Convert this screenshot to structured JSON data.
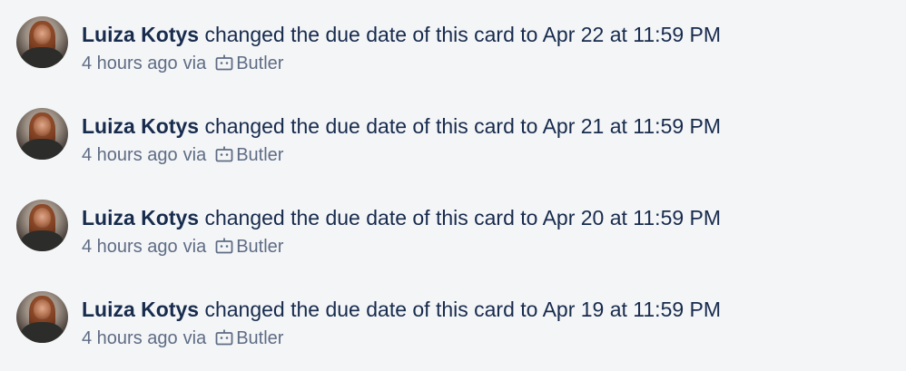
{
  "activities": [
    {
      "author": "Luiza Kotys",
      "action": "changed the due date of this card to Apr 22 at 11:59 PM",
      "time": "4 hours ago",
      "via": "via",
      "source": "Butler",
      "avatar_icon": "user-avatar",
      "source_icon": "robot-icon"
    },
    {
      "author": "Luiza Kotys",
      "action": "changed the due date of this card to Apr 21 at 11:59 PM",
      "time": "4 hours ago",
      "via": "via",
      "source": "Butler",
      "avatar_icon": "user-avatar",
      "source_icon": "robot-icon"
    },
    {
      "author": "Luiza Kotys",
      "action": "changed the due date of this card to Apr 20 at 11:59 PM",
      "time": "4 hours ago",
      "via": "via",
      "source": "Butler",
      "avatar_icon": "user-avatar",
      "source_icon": "robot-icon"
    },
    {
      "author": "Luiza Kotys",
      "action": "changed the due date of this card to Apr 19 at 11:59 PM",
      "time": "4 hours ago",
      "via": "via",
      "source": "Butler",
      "avatar_icon": "user-avatar",
      "source_icon": "robot-icon"
    }
  ],
  "colors": {
    "background": "#f4f5f7",
    "primary_text": "#172b4d",
    "secondary_text": "#5e6c84"
  }
}
